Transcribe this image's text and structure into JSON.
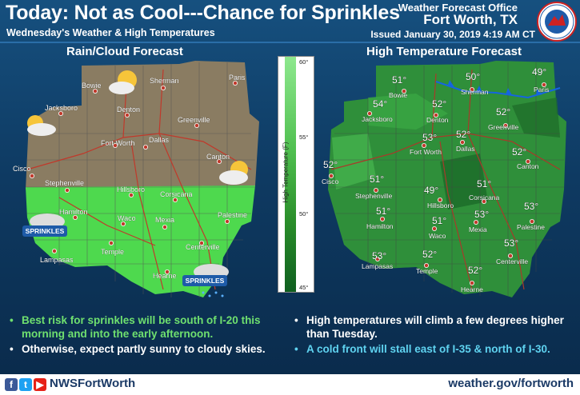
{
  "header": {
    "title": "Today: Not as Cool---Chance for Sprinkles",
    "subtitle": "Wednesday's Weather & High Temperatures",
    "office_line1": "Weather Forecast Office",
    "office_line2": "Fort Worth, TX",
    "issued": "Issued January 30, 2019 4:19 AM CT"
  },
  "left_panel": {
    "title": "Rain/Cloud Forecast",
    "cities": [
      "Bowie",
      "Sherman",
      "Paris",
      "Jacksboro",
      "Denton",
      "Greenville",
      "Fort Worth",
      "Dallas",
      "Canton",
      "Cisco",
      "Stephenville",
      "Hillsboro",
      "Corsicana",
      "Hamilton",
      "Waco",
      "Mexia",
      "Palestine",
      "Lampasas",
      "Temple",
      "Centerville",
      "Hearne"
    ],
    "sprinkles_label_1": "SPRINKLES",
    "sprinkles_label_2": "SPRINKLES"
  },
  "colorbar": {
    "label": "High Temperature (F)",
    "ticks": [
      "60°",
      "55°",
      "50°",
      "45°"
    ]
  },
  "right_panel": {
    "title": "High Temperature Forecast",
    "temps": [
      {
        "city": "Bowie",
        "temp": "51°"
      },
      {
        "city": "Sherman",
        "temp": "50°"
      },
      {
        "city": "Paris",
        "temp": "49°"
      },
      {
        "city": "Jacksboro",
        "temp": "54°"
      },
      {
        "city": "Denton",
        "temp": "52°"
      },
      {
        "city": "Greenville",
        "temp": "52°"
      },
      {
        "city": "Fort Worth",
        "temp": "53°"
      },
      {
        "city": "Dallas",
        "temp": "52°"
      },
      {
        "city": "Canton",
        "temp": "52°"
      },
      {
        "city": "Cisco",
        "temp": "52°"
      },
      {
        "city": "Stephenville",
        "temp": "51°"
      },
      {
        "city": "Hillsboro",
        "temp": "49°"
      },
      {
        "city": "Corsicana",
        "temp": "51°"
      },
      {
        "city": "Hamilton",
        "temp": "51°"
      },
      {
        "city": "Waco",
        "temp": "51°"
      },
      {
        "city": "Mexia",
        "temp": "53°"
      },
      {
        "city": "Palestine",
        "temp": "53°"
      },
      {
        "city": "Lampasas",
        "temp": "53°"
      },
      {
        "city": "Temple",
        "temp": "52°"
      },
      {
        "city": "Centerville",
        "temp": "53°"
      },
      {
        "city": "Hearne",
        "temp": "52°"
      }
    ]
  },
  "bullets_left": [
    {
      "text": "Best risk for sprinkles will be south of I-20 this morning and into the early afternoon.",
      "color": "#6fe06f"
    },
    {
      "text": "Otherwise, expect partly sunny to cloudy skies.",
      "color": "#ffffff"
    }
  ],
  "bullets_right": [
    {
      "text": "High temperatures will climb a few degrees higher than Tuesday.",
      "color": "#ffffff"
    },
    {
      "text": "A cold front will stall east of I-35 & north of I-30.",
      "color": "#5fd3f0"
    }
  ],
  "footer": {
    "handle": "NWSFortWorth",
    "url": "weather.gov/fortworth"
  }
}
